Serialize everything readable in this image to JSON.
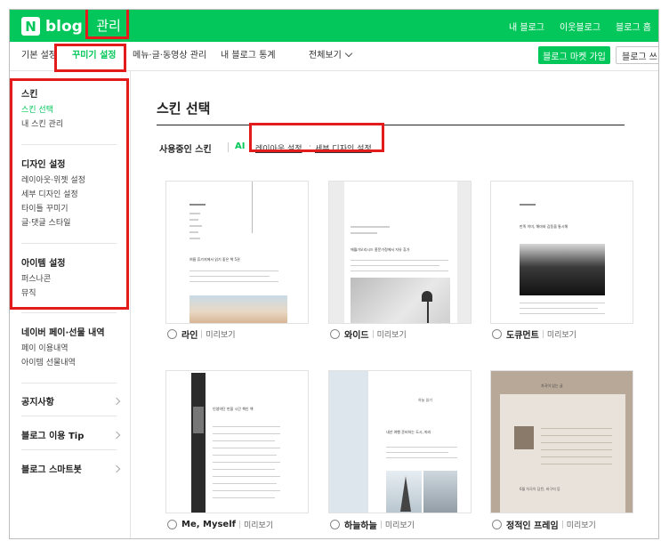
{
  "topbar": {
    "logo_letter": "N",
    "logo_text": "blog",
    "management_label": "관리",
    "links": [
      "내 블로그",
      "이웃블로그",
      "블로그 홈"
    ]
  },
  "subnav": {
    "tabs": [
      "기본 설정",
      "꾸미기 설정",
      "메뉴·글·동영상 관리",
      "내 블로그 통계",
      "전체보기"
    ],
    "active_tab": "꾸미기 설정",
    "market_button": "블로그 마켓 가입",
    "blog_button": "블로그 쓰기"
  },
  "sidebar": {
    "skin_section": {
      "title": "스킨",
      "items": [
        "스킨 선택",
        "내 스킨 관리"
      ]
    },
    "design_section": {
      "title": "디자인 설정",
      "items": [
        "레이아웃·위젯 설정",
        "세부 디자인 설정",
        "타이틀 꾸미기",
        "글·댓글 스타일"
      ]
    },
    "item_section": {
      "title": "아이템 설정",
      "items": [
        "퍼스나콘",
        "뮤직"
      ]
    },
    "pay_section": {
      "title": "네이버 페이·선물 내역",
      "items": [
        "페이 이용내역",
        "아이템 선물내역"
      ]
    },
    "links": [
      "공지사항",
      "블로그 이용 Tip",
      "블로그 스마트봇"
    ],
    "active_item": "스킨 선택"
  },
  "main": {
    "title": "스킨 선택",
    "using_label": "사용중인 스킨",
    "using_skin": "AI",
    "layout_link": "레이아웃 설정",
    "detail_link": "세부 디자인 설정",
    "preview_label": "미리보기",
    "card_texts": {
      "line": "여름 휴가지에서 읽기 좋은 책 5권",
      "wide": "애월가오리시드 홈문가정에서 자유 휴가",
      "document": "만족 이미, 해마와 감동을 통시해",
      "me": "인생약단 만을 시간 책인 책",
      "sky_name": "하늘 읽기",
      "sky": "내년 여행 준비하는 도시, 파리",
      "frame_title": "차곡이 있는 글",
      "frame": "6월 차곡이 담된, 바구미 등"
    },
    "skins": [
      {
        "name": "라인"
      },
      {
        "name": "와이드"
      },
      {
        "name": "도큐먼트"
      },
      {
        "name": "Me, Myself"
      },
      {
        "name": "하늘하늘"
      },
      {
        "name": "정적인 프레임"
      }
    ]
  },
  "colors": {
    "brand_green": "#03c75a",
    "annotation_red": "#e41b1b"
  }
}
